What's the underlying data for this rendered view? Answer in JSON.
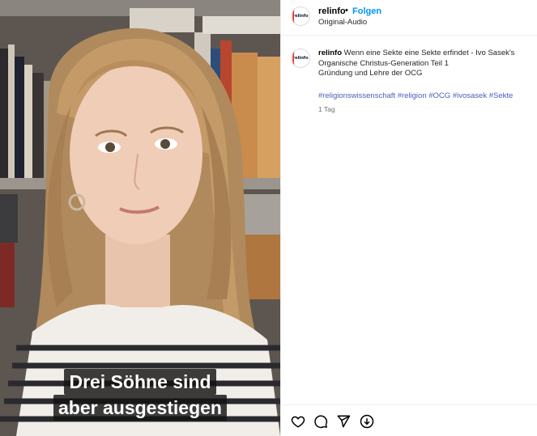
{
  "video": {
    "subtitle_lines": [
      "Drei Söhne sind",
      "aber ausgestiegen"
    ]
  },
  "header": {
    "username": "relinfo",
    "separator": "•",
    "follow_label": "Folgen",
    "audio_label": "Original-Audio",
    "avatar_logo_text": "relinfo"
  },
  "post": {
    "username": "relinfo",
    "caption_title": "Wenn eine Sekte eine Sekte erfindet - Ivo Sasek's Organische Christus-Generation Teil 1",
    "caption_subtitle": "Gründung und Lehre der OCG",
    "hashtags": [
      "#religionswissenschaft",
      "#religion",
      "#OCG",
      "#ivosasek",
      "#Sekte"
    ],
    "time_ago": "1 Tag"
  },
  "actions": {
    "icons": [
      "heart-icon",
      "comment-icon",
      "share-icon",
      "save-icon"
    ]
  },
  "colors": {
    "follow_blue": "#0095f6",
    "hashtag_blue": "#4a5dbb",
    "subtitle_bg": "#141414"
  }
}
